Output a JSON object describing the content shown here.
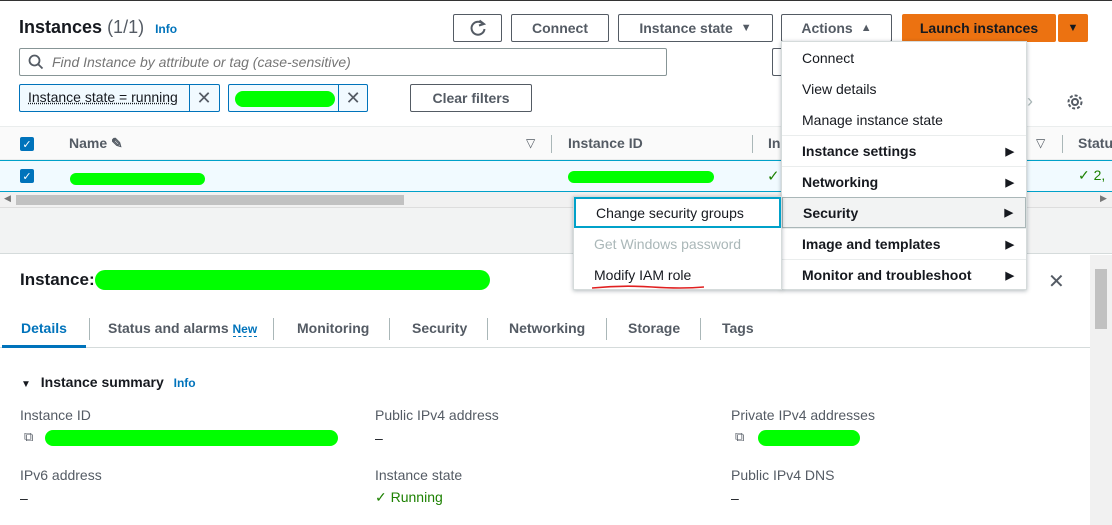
{
  "header": {
    "title": "Instances",
    "count": "(1/1)",
    "info": "Info",
    "refresh_icon": "refresh-icon",
    "connect": "Connect",
    "instance_state": "Instance state",
    "actions": "Actions",
    "launch": "Launch instances"
  },
  "search": {
    "placeholder": "Find Instance by attribute or tag (case-sensitive)"
  },
  "filters": {
    "token1": "Instance state = running",
    "clear": "Clear filters"
  },
  "table": {
    "columns": [
      "Name",
      "Instance ID",
      "In",
      "Statu"
    ],
    "row": {
      "status_partial": "2,"
    }
  },
  "actions_menu": {
    "items": [
      {
        "label": "Connect"
      },
      {
        "label": "View details"
      },
      {
        "label": "Manage instance state"
      },
      {
        "label": "Instance settings"
      },
      {
        "label": "Networking"
      },
      {
        "label": "Security"
      },
      {
        "label": "Image and templates"
      },
      {
        "label": "Monitor and troubleshoot"
      }
    ]
  },
  "security_submenu": {
    "items": [
      {
        "label": "Change security groups"
      },
      {
        "label": "Get Windows password"
      },
      {
        "label": "Modify IAM role"
      }
    ]
  },
  "details": {
    "title_prefix": "Instance:",
    "tabs": [
      "Details",
      "Status and alarms",
      "Monitoring",
      "Security",
      "Networking",
      "Storage",
      "Tags"
    ],
    "new_badge": "New",
    "summary_title": "Instance summary",
    "summary_info": "Info",
    "fields": {
      "instance_id_label": "Instance ID",
      "public_ipv4_label": "Public IPv4 address",
      "public_ipv4_value": "–",
      "private_ipv4_label": "Private IPv4 addresses",
      "ipv6_label": "IPv6 address",
      "ipv6_value": "–",
      "state_label": "Instance state",
      "state_value": "Running",
      "dns_label": "Public IPv4 DNS",
      "dns_value": "–"
    }
  },
  "colors": {
    "accent": "#0073bb",
    "launch": "#ec7211",
    "success": "#1d8102",
    "redact": "#00ff00"
  }
}
